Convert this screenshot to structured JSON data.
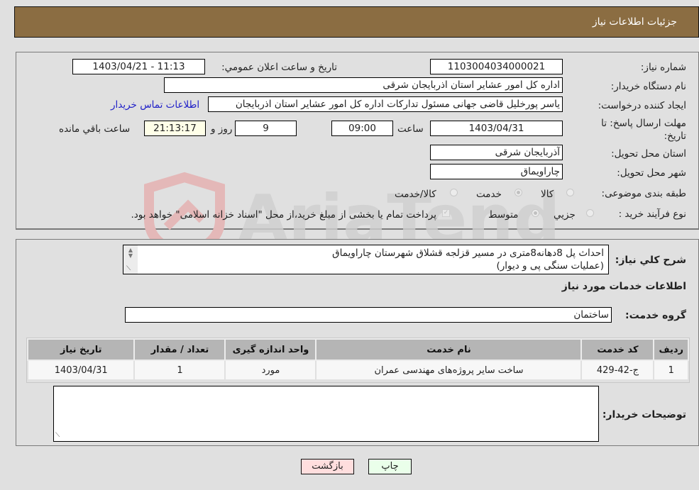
{
  "header": {
    "title": "جزئيات اطلاعات نیاز"
  },
  "details": {
    "need_number_label": "شماره نیاز:",
    "need_number": "1103004034000021",
    "announce_datetime_label": "تاريخ و ساعت اعلان عمومي:",
    "announce_datetime": "1403/04/21 - 11:13",
    "buyer_org_label": "نام دستگاه خریدار:",
    "buyer_org": "اداره کل امور عشایر استان اذربایجان شرقی",
    "requester_label": "ایجاد کننده درخواست:",
    "requester": "یاسر پورخلیل قاضی جهانی مسئول تدارکات اداره کل امور عشایر استان اذربایجان",
    "buyer_contact_link": "اطلاعات تماس خریدار",
    "deadline_label": "مهلت ارسال پاسخ: تا تاریخ:",
    "deadline_date": "1403/04/31",
    "time_label": "ساعت",
    "deadline_time": "09:00",
    "days_value": "9",
    "days_label": "روز و",
    "remaining_time": "21:13:17",
    "remaining_label": "ساعت باقي مانده",
    "province_label": "استان محل تحویل:",
    "province": "آذربایجان شرقی",
    "city_label": "شهر محل تحویل:",
    "city": "چاراویماق",
    "category_label": "طبقه بندی موضوعی:",
    "category_options": [
      {
        "label": "کالا",
        "checked": false
      },
      {
        "label": "خدمت",
        "checked": true
      },
      {
        "label": "کالا/خدمت",
        "checked": false
      }
    ],
    "process_label": "نوع فرآیند خرید :",
    "process_options": [
      {
        "label": "جزيي",
        "checked": false
      },
      {
        "label": "متوسط",
        "checked": true
      }
    ],
    "treasury_checkbox_label": "پرداخت تمام یا بخشی از مبلغ خرید،از محل \"اسناد خزانه اسلامی\" خواهد بود.",
    "treasury_checked": true
  },
  "description": {
    "label": "شرح کلي نياز:",
    "text_line1": "احداث پل 8دهانه8متری در مسیر قزلجه قشلاق شهرستان چاراویماق",
    "text_line2": "(عملیات سنگی پی و دیوار)"
  },
  "services": {
    "section_title": "اطلاعات خدمات مورد نیاز",
    "group_label": "گروه خدمت:",
    "group_value": "ساختمان",
    "table": {
      "headers": [
        "ردیف",
        "کد خدمت",
        "نام خدمت",
        "واحد اندازه گیری",
        "تعداد / مقدار",
        "تاریخ نیاز"
      ],
      "rows": [
        [
          "1",
          "ج-42-429",
          "ساخت سایر پروژه‌های مهندسی عمران",
          "مورد",
          "1",
          "1403/04/31"
        ]
      ]
    }
  },
  "buyer_notes": {
    "label": "توضیحات خریدار:",
    "value": ""
  },
  "buttons": {
    "print": "چاپ",
    "back": "بازگشت"
  },
  "watermark": {
    "text": "AriaTender.neT"
  },
  "colors": {
    "header_bg": "#8b6d42",
    "link": "#2020c8",
    "print_bg": "#eaffea",
    "back_bg": "#ffdede"
  }
}
